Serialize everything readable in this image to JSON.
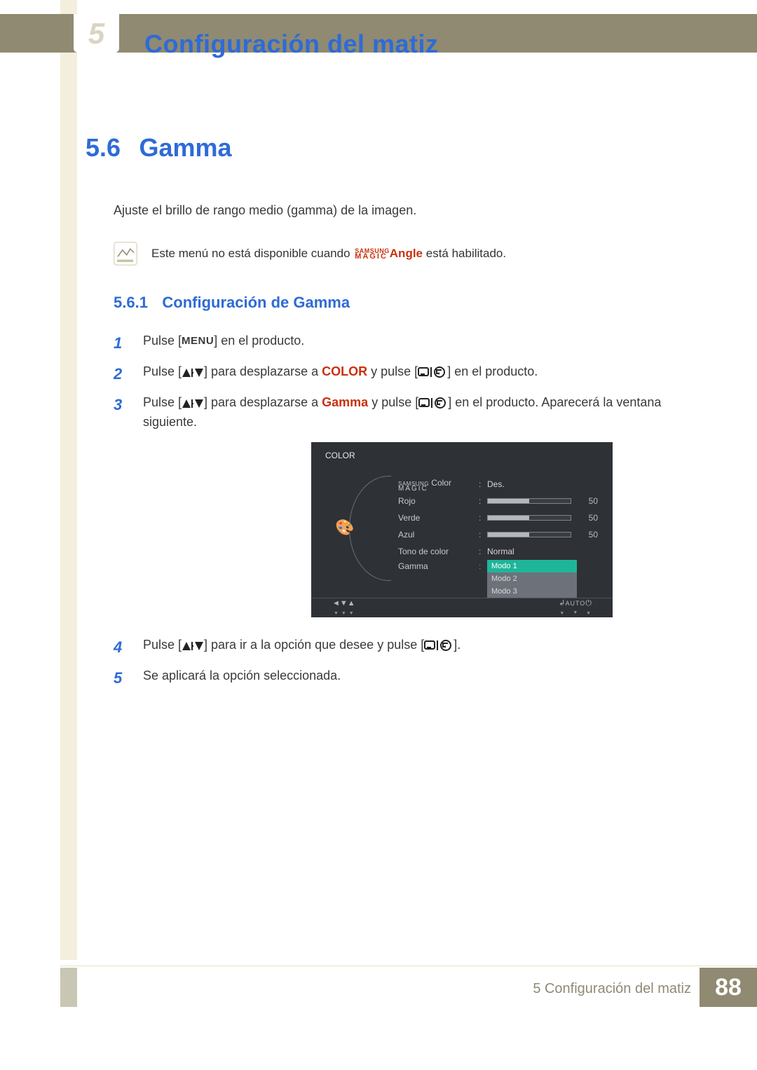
{
  "chapter": {
    "tab_number": "5",
    "title": "Configuración del matiz"
  },
  "section": {
    "number": "5.6",
    "name": "Gamma"
  },
  "intro": "Ajuste el brillo de rango medio (gamma) de la imagen.",
  "note": {
    "pre": "Este menú no está disponible cuando ",
    "samsung": "SAMSUNG",
    "magic": "MAGIC",
    "angle": "Angle",
    "post": " está habilitado."
  },
  "subsection": {
    "number": "5.6.1",
    "name": "Configuración de Gamma"
  },
  "steps": [
    {
      "n": "1",
      "pre": "Pulse [",
      "key": "MENU",
      "post": "] en el producto."
    },
    {
      "n": "2",
      "pre": "Pulse [",
      "mid1": "] para desplazarse a ",
      "target": "COLOR",
      "mid2": " y pulse [",
      "post": "] en el producto."
    },
    {
      "n": "3",
      "pre": "Pulse [",
      "mid1": "] para desplazarse a ",
      "target": "Gamma",
      "mid2": " y pulse [",
      "post": "] en el producto. Aparecerá la ventana siguiente."
    },
    {
      "n": "4",
      "pre": "Pulse [",
      "mid1": "] para ir a la opción que desee y pulse [",
      "post": "]."
    },
    {
      "n": "5",
      "text": "Se aplicará la opción seleccionada."
    }
  ],
  "osd": {
    "title": "COLOR",
    "rows": {
      "magic_color": {
        "label_top": "SAMSUNG",
        "label_bottom": "MAGIC",
        "suffix": " Color",
        "value": "Des."
      },
      "rojo": {
        "label": "Rojo",
        "value": "50"
      },
      "verde": {
        "label": "Verde",
        "value": "50"
      },
      "azul": {
        "label": "Azul",
        "value": "50"
      },
      "tono": {
        "label": "Tono de color",
        "value": "Normal"
      },
      "gamma": {
        "label": "Gamma",
        "options": [
          "Modo 1",
          "Modo 2",
          "Modo 3"
        ]
      }
    },
    "footer_auto": "AUTO"
  },
  "footer": {
    "text": "5 Configuración del matiz",
    "page": "88"
  }
}
